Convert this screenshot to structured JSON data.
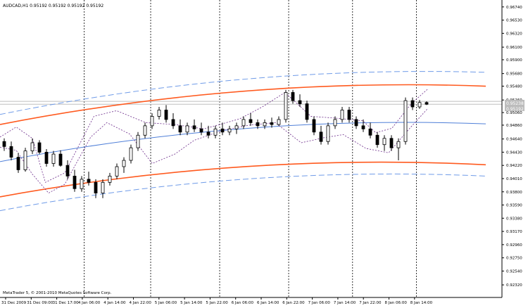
{
  "window": {
    "title": "AUDCAD,H1  0.95192 0.95192 0.95192 0.95192",
    "footer": "MetaTrader 5, © 2001-2010 MetaQuotes Software Corp."
  },
  "price_tags": {
    "upper": "0.95238",
    "lower": "0.95192"
  },
  "colors": {
    "background": "#ffffff",
    "axis": "#000000",
    "candle_up": "#ffffff",
    "candle_down": "#000000",
    "regression_channel_inner": "#ff5a1f",
    "regression_channel_outer": "#6f9be8",
    "regression_midline": "#4f7fd8",
    "envelope_dotted": "#6b2a8a",
    "price_line": "#bfbfbf"
  },
  "chart_data": {
    "type": "candlestick",
    "symbol": "AUDCAD",
    "timeframe": "H1",
    "ylim": [
      0.9212,
      0.9685
    ],
    "y_ticks": [
      "0.96740",
      "0.96530",
      "0.96320",
      "0.96100",
      "0.95900",
      "0.95680",
      "0.95480",
      "0.95260",
      "0.95060",
      "0.94860",
      "0.94640",
      "0.94430",
      "0.94220",
      "0.94010",
      "0.93800",
      "0.93590",
      "0.93380",
      "0.93170",
      "0.92960",
      "0.92750",
      "0.92540",
      "0.92320"
    ],
    "x_ticks": [
      "31 Dec 2009",
      "31 Dec 09:00",
      "31 Dec 17:00",
      "4 Jan 06:00",
      "4 Jan 14:00",
      "4 Jan 22:00",
      "5 Jan 06:00",
      "5 Jan 14:00",
      "5 Jan 22:00",
      "6 Jan 06:00",
      "6 Jan 14:00",
      "6 Jan 22:00",
      "7 Jan 06:00",
      "7 Jan 14:00",
      "7 Jan 22:00",
      "8 Jan 06:00",
      "8 Jan 14:00"
    ],
    "period_separators_at_tick_index": [
      2.8,
      5.4,
      8.1,
      10.8,
      13.3,
      15.8
    ],
    "channel_inner_upper": {
      "start": 0.9487,
      "end": 0.9548
    },
    "channel_inner_lower": {
      "start": 0.9372,
      "end": 0.9423
    },
    "channel_outer_upper": {
      "start": 0.9503,
      "end": 0.957
    },
    "channel_outer_lower": {
      "start": 0.935,
      "end": 0.9405
    },
    "channel_midline": {
      "start": 0.9428,
      "end": 0.9488
    },
    "envelope_upper_points": [
      [
        0,
        0.9467
      ],
      [
        10,
        0.9483
      ],
      [
        20,
        0.9465
      ],
      [
        28,
        0.9395
      ],
      [
        40,
        0.941
      ],
      [
        58,
        0.95
      ],
      [
        72,
        0.9509
      ],
      [
        90,
        0.949
      ],
      [
        108,
        0.9487
      ],
      [
        126,
        0.948
      ],
      [
        148,
        0.9496
      ],
      [
        162,
        0.9515
      ],
      [
        176,
        0.9538
      ],
      [
        192,
        0.95
      ],
      [
        208,
        0.9497
      ],
      [
        224,
        0.9493
      ],
      [
        232,
        0.9474
      ],
      [
        242,
        0.9481
      ],
      [
        254,
        0.952
      ],
      [
        264,
        0.9543
      ]
    ],
    "envelope_lower_points": [
      [
        0,
        0.9451
      ],
      [
        10,
        0.9446
      ],
      [
        20,
        0.9408
      ],
      [
        30,
        0.9378
      ],
      [
        40,
        0.9392
      ],
      [
        56,
        0.9467
      ],
      [
        66,
        0.949
      ],
      [
        80,
        0.9472
      ],
      [
        94,
        0.9425
      ],
      [
        108,
        0.944
      ],
      [
        120,
        0.9462
      ],
      [
        138,
        0.9478
      ],
      [
        154,
        0.9486
      ],
      [
        170,
        0.949
      ],
      [
        186,
        0.9458
      ],
      [
        200,
        0.9466
      ],
      [
        212,
        0.9471
      ],
      [
        226,
        0.9449
      ],
      [
        240,
        0.9442
      ],
      [
        252,
        0.9478
      ],
      [
        264,
        0.9512
      ]
    ],
    "candles": [
      [
        0.946,
        0.9465,
        0.9445,
        0.9452
      ],
      [
        0.9452,
        0.946,
        0.943,
        0.9435
      ],
      [
        0.9435,
        0.9442,
        0.941,
        0.9415
      ],
      [
        0.9415,
        0.945,
        0.9412,
        0.9445
      ],
      [
        0.9445,
        0.9465,
        0.944,
        0.9458
      ],
      [
        0.9458,
        0.9462,
        0.944,
        0.9443
      ],
      [
        0.9443,
        0.9448,
        0.942,
        0.9425
      ],
      [
        0.9425,
        0.9445,
        0.942,
        0.944
      ],
      [
        0.944,
        0.9446,
        0.942,
        0.9422
      ],
      [
        0.9422,
        0.943,
        0.94,
        0.9405
      ],
      [
        0.9405,
        0.9415,
        0.938,
        0.9385
      ],
      [
        0.9385,
        0.9405,
        0.938,
        0.94
      ],
      [
        0.94,
        0.9412,
        0.939,
        0.9395
      ],
      [
        0.9395,
        0.94,
        0.937,
        0.9378
      ],
      [
        0.9378,
        0.94,
        0.937,
        0.9395
      ],
      [
        0.9395,
        0.941,
        0.939,
        0.9405
      ],
      [
        0.9405,
        0.9425,
        0.94,
        0.942
      ],
      [
        0.942,
        0.9435,
        0.941,
        0.943
      ],
      [
        0.943,
        0.9455,
        0.9425,
        0.945
      ],
      [
        0.945,
        0.9475,
        0.9445,
        0.947
      ],
      [
        0.947,
        0.949,
        0.9465,
        0.9485
      ],
      [
        0.9485,
        0.9505,
        0.948,
        0.95
      ],
      [
        0.95,
        0.9515,
        0.9495,
        0.951
      ],
      [
        0.951,
        0.9518,
        0.949,
        0.9495
      ],
      [
        0.9495,
        0.9505,
        0.948,
        0.9485
      ],
      [
        0.9485,
        0.9495,
        0.947,
        0.9475
      ],
      [
        0.9475,
        0.949,
        0.947,
        0.9485
      ],
      [
        0.9485,
        0.9495,
        0.9475,
        0.948
      ],
      [
        0.948,
        0.949,
        0.947,
        0.9475
      ],
      [
        0.9475,
        0.9485,
        0.9465,
        0.947
      ],
      [
        0.947,
        0.9485,
        0.9465,
        0.948
      ],
      [
        0.948,
        0.949,
        0.947,
        0.9475
      ],
      [
        0.9475,
        0.9485,
        0.947,
        0.948
      ],
      [
        0.948,
        0.949,
        0.9472,
        0.9485
      ],
      [
        0.9485,
        0.95,
        0.948,
        0.9495
      ],
      [
        0.9495,
        0.9505,
        0.9485,
        0.949
      ],
      [
        0.949,
        0.9495,
        0.948,
        0.9485
      ],
      [
        0.9485,
        0.9495,
        0.948,
        0.949
      ],
      [
        0.949,
        0.9498,
        0.9482,
        0.9487
      ],
      [
        0.9487,
        0.95,
        0.9485,
        0.9495
      ],
      [
        0.9495,
        0.9542,
        0.949,
        0.9538
      ],
      [
        0.9538,
        0.9542,
        0.952,
        0.9525
      ],
      [
        0.9525,
        0.9535,
        0.9515,
        0.952
      ],
      [
        0.952,
        0.9525,
        0.949,
        0.9495
      ],
      [
        0.9495,
        0.95,
        0.947,
        0.9475
      ],
      [
        0.9475,
        0.9485,
        0.9455,
        0.946
      ],
      [
        0.946,
        0.949,
        0.9455,
        0.9485
      ],
      [
        0.9485,
        0.95,
        0.948,
        0.9495
      ],
      [
        0.9495,
        0.9515,
        0.949,
        0.951
      ],
      [
        0.951,
        0.9515,
        0.949,
        0.9495
      ],
      [
        0.9495,
        0.95,
        0.948,
        0.9485
      ],
      [
        0.9485,
        0.9495,
        0.9475,
        0.948
      ],
      [
        0.948,
        0.949,
        0.9465,
        0.947
      ],
      [
        0.947,
        0.9475,
        0.945,
        0.9455
      ],
      [
        0.9455,
        0.947,
        0.9445,
        0.9465
      ],
      [
        0.9465,
        0.947,
        0.9445,
        0.945
      ],
      [
        0.945,
        0.9465,
        0.943,
        0.946
      ],
      [
        0.946,
        0.953,
        0.9455,
        0.9525
      ],
      [
        0.9525,
        0.953,
        0.951,
        0.9515
      ],
      [
        0.9515,
        0.9526,
        0.9512,
        0.9522
      ],
      [
        0.9522,
        0.9524,
        0.9518,
        0.95192
      ]
    ]
  }
}
